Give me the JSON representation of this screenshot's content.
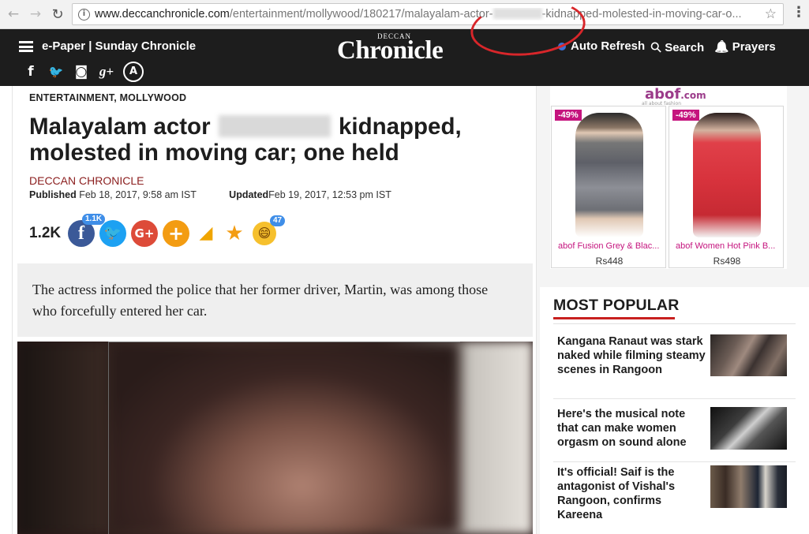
{
  "browser": {
    "url_host": "www.deccanchronicle.com",
    "url_path_start": "/entertainment/mollywood/180217/malayalam-actor-",
    "url_path_end": "-kidnapped-molested-in-moving-car-o...",
    "info_glyph": "i",
    "star_glyph": "☆",
    "menu_glyph": "⋮",
    "back_glyph": "←",
    "forward_glyph": "→",
    "reload_glyph": "↻"
  },
  "header": {
    "epaper_label": "e-Paper | Sunday Chronicle",
    "logo_small": "DECCAN",
    "logo_main": "Chronicle",
    "auto_refresh_label": "Auto Refresh",
    "search_label": "Search",
    "prayers_label": "Prayers",
    "search_glyph": "⚲",
    "bell_glyph": "🔔",
    "social": [
      {
        "name": "facebook-icon",
        "glyph": "f"
      },
      {
        "name": "twitter-icon",
        "glyph": "🐦"
      },
      {
        "name": "instagram-icon",
        "glyph": "◙"
      },
      {
        "name": "google-plus-icon",
        "glyph": "g+"
      },
      {
        "name": "app-store-icon",
        "glyph": "A"
      }
    ]
  },
  "article": {
    "category": "ENTERTAINMENT, MOLLYWOOD",
    "headline_start": "Malayalam actor",
    "headline_end": "kidnapped, molested in moving car; one held",
    "byline": "DECCAN CHRONICLE",
    "published_label": "Published",
    "published_value": " Feb 18, 2017, 9:58 am IST",
    "updated_label": "Updated",
    "updated_value": "Feb 19, 2017, 12:53 pm IST",
    "share_count": "1.2K",
    "fb_badge": "1.1K",
    "emoji_badge": "47",
    "share_glyphs": {
      "facebook": "f",
      "twitter": "🐦",
      "googleplus": "G+",
      "plus": "+",
      "tag": "◢",
      "star": "★",
      "emoji": "😄"
    },
    "summary": "The actress informed the police that her former driver, Martin, was among those who forcefully entered her car."
  },
  "ad": {
    "logo": "abof",
    "logo_suffix": ".com",
    "tagline": "all about fashion",
    "items": [
      {
        "discount": "-49%",
        "name": "abof Fusion Grey & Blac...",
        "price": "Rs448"
      },
      {
        "discount": "-49%",
        "name": "abof Women Hot Pink B...",
        "price": "Rs498"
      }
    ]
  },
  "popular": {
    "title": "MOST POPULAR",
    "items": [
      {
        "title": "Kangana Ranaut was stark naked while filming steamy scenes in Rangoon"
      },
      {
        "title": "Here's the musical note that can make women orgasm on sound alone"
      },
      {
        "title": "It's official! Saif is the antagonist of Vishal's Rangoon, confirms Kareena"
      }
    ]
  }
}
